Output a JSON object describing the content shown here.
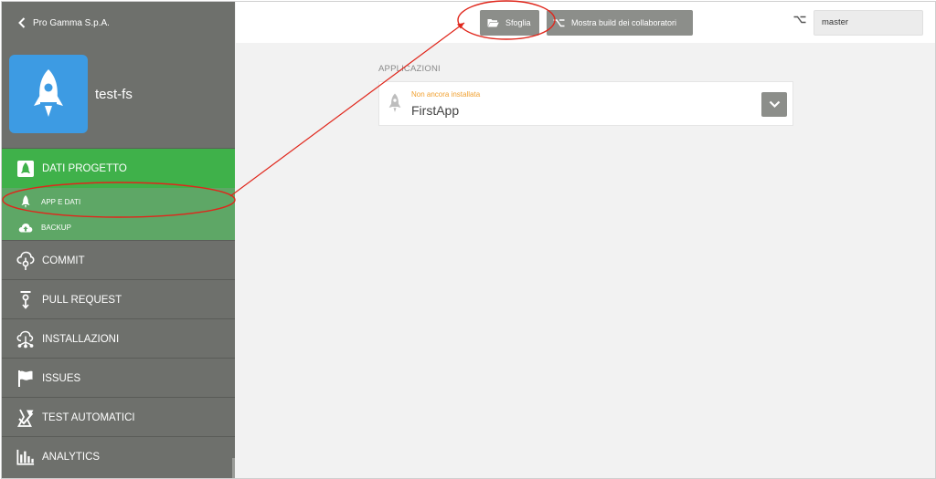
{
  "org": {
    "back_label": "Pro Gamma S.p.A."
  },
  "project": {
    "name": "test-fs"
  },
  "sidebar": {
    "active": {
      "label": "DATI PROGETTO",
      "icon": "project-data-icon"
    },
    "sub_items": [
      {
        "label": "APP E DATI",
        "icon": "rocket-icon"
      },
      {
        "label": "BACKUP",
        "icon": "cloud-upload-icon"
      }
    ],
    "items": [
      {
        "label": "COMMIT",
        "icon": "commit-icon"
      },
      {
        "label": "PULL REQUEST",
        "icon": "pull-request-icon"
      },
      {
        "label": "INSTALLAZIONI",
        "icon": "installations-icon"
      },
      {
        "label": "ISSUES",
        "icon": "flag-icon"
      },
      {
        "label": "TEST AUTOMATICI",
        "icon": "automated-test-icon"
      },
      {
        "label": "ANALYTICS",
        "icon": "analytics-icon"
      }
    ]
  },
  "toolbar": {
    "browse_label": "Sfoglia",
    "show_builds_label": "Mostra build dei collaboratori",
    "branch_value": "master"
  },
  "main": {
    "section_title": "APPLICAZIONI",
    "apps": [
      {
        "status": "Non ancora installata",
        "name": "FirstApp"
      }
    ]
  },
  "colors": {
    "sidebar_bg": "#6e706c",
    "active_green": "#3fb14a",
    "sub_green": "#5ea766",
    "annotation_red": "#e0261b",
    "status_orange": "#f0a030",
    "avatar_blue": "#3d9be3"
  }
}
